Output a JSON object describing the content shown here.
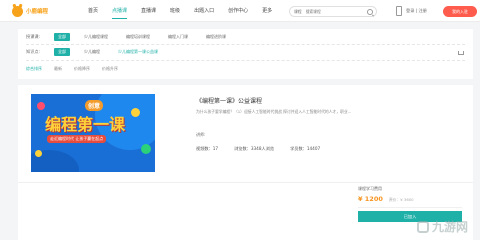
{
  "brand": {
    "name": "小鹿编程"
  },
  "nav": [
    "首页",
    "点播课",
    "直播课",
    "班级",
    "出题入口",
    "创作中心",
    "更多"
  ],
  "search": {
    "scope": "课程",
    "placeholder": "搜索课程"
  },
  "header": {
    "login": "登录 | 注册",
    "teacher_button": "我的入驻"
  },
  "filter": {
    "row1": {
      "label": "授课课:",
      "items": [
        "全部",
        "少儿编程课程",
        "编程培训课程",
        "编程入门课",
        "编程进阶课"
      ]
    },
    "row2": {
      "label": "知识点:",
      "items": [
        "全部",
        "少儿编程",
        "少儿编程第一课公益课"
      ]
    },
    "sorts": [
      "综合排序",
      "最新",
      "价格降序",
      "价格升序"
    ]
  },
  "course": {
    "banner": {
      "badge": "创意",
      "title": "编程第一课",
      "subtitle": "走近编程时代 让孩子赢在起点"
    },
    "title": "《编程第一课》公益课程",
    "desc": "为什么孩子要学编程？（1）迎接人工智能时代挑战 探讨并迎入人工智能时代的人才，职业...",
    "teacher": "讲师:",
    "stats": {
      "videos": "视频数：17",
      "learners": "浏览数：3348人浏览",
      "students": "学员数：14407"
    },
    "price_type": "课程学习费用",
    "price": "¥ 1200",
    "price_old": "原价：¥ 3600",
    "join": "已加入"
  },
  "watermark": "九游网"
}
